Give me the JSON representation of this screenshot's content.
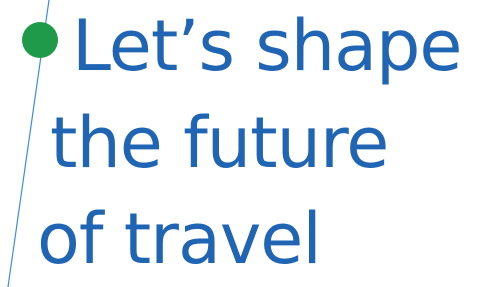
{
  "headline": {
    "line_1": "Let’s shape",
    "line_2": "the future",
    "line_3": "of travel"
  },
  "colors": {
    "text": "#1f65b4",
    "accent_dot": "#1f9a4a",
    "thin_line": "#3b8fe0"
  }
}
